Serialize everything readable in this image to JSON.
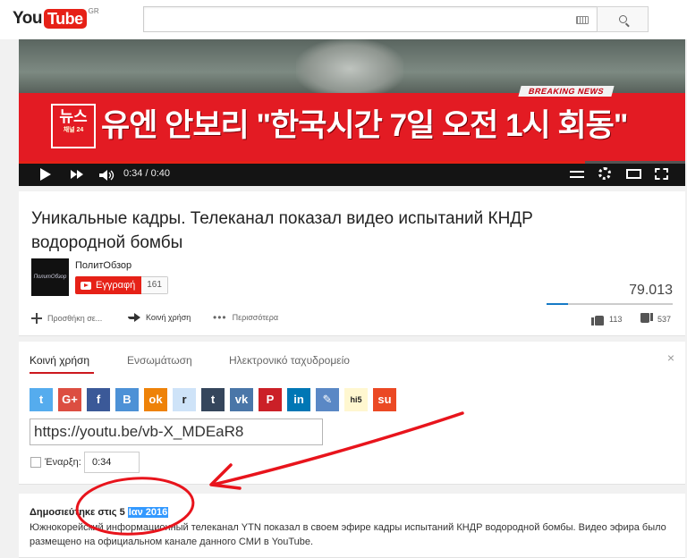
{
  "header": {
    "logo_you": "You",
    "logo_tube": "Tube",
    "logo_region": "GR",
    "search_placeholder": ""
  },
  "video": {
    "breaking_label": "BREAKING NEWS",
    "news_logo": "뉴스",
    "news_logo_sub": "채널 24",
    "headline": "유엔 안보리 \"한국시간 7일 오전 1시 회동\"",
    "time": "0:34 / 0:40",
    "progress_fraction": 0.85
  },
  "info": {
    "title": "Уникальные кадры. Телеканал показал видео испытаний КНДР водородной бомбы",
    "channel_name": "ПолитОбзор",
    "avatar_text": "ПолитОбзор",
    "subscribe_label": "Εγγραφή",
    "subscriber_count": "161",
    "views": "79.013",
    "like_fraction": 0.17,
    "actions": {
      "add": "Προσθήκη σε...",
      "share": "Κοινή χρήση",
      "more": "Περισσότερα"
    },
    "likes": "113",
    "dislikes": "537"
  },
  "share": {
    "tabs": [
      "Κοινή χρήση",
      "Ενσωμάτωση",
      "Ηλεκτρονικό ταχυδρομείο"
    ],
    "close": "×",
    "socials": [
      {
        "name": "twitter",
        "glyph": "t",
        "color": "#55acee"
      },
      {
        "name": "google-plus",
        "glyph": "G+",
        "color": "#dc4e41"
      },
      {
        "name": "facebook",
        "glyph": "f",
        "color": "#3b5998"
      },
      {
        "name": "blogger",
        "glyph": "B",
        "color": "#4d91d6"
      },
      {
        "name": "odnoklassniki",
        "glyph": "ok",
        "color": "#ee8208"
      },
      {
        "name": "reddit",
        "glyph": "r",
        "color": "#cee3f8"
      },
      {
        "name": "tumblr",
        "glyph": "t",
        "color": "#35465c"
      },
      {
        "name": "vk",
        "glyph": "vk",
        "color": "#4a76a8"
      },
      {
        "name": "pinterest",
        "glyph": "P",
        "color": "#cb2027"
      },
      {
        "name": "linkedin",
        "glyph": "in",
        "color": "#0077b5"
      },
      {
        "name": "livejournal",
        "glyph": "✎",
        "color": "#5a88c5"
      },
      {
        "name": "hi5",
        "glyph": "hi5",
        "color": "#fff7d0"
      },
      {
        "name": "stumbleupon",
        "glyph": "su",
        "color": "#eb4924"
      }
    ],
    "url": "https://youtu.be/vb-X_MDEaR8",
    "start_label": "Έναρξη:",
    "start_value": "0:34"
  },
  "description": {
    "published_prefix": "Δημοσιεύτηκε στις 5 ",
    "published_date": "Ιαν 2016",
    "text": "Южнокорейский информационный телеканал YTN показал в своем эфире кадры испытаний КНДР водородной бомбы. Видео эфира было размещено на официальном канале данного СМИ в YouTube."
  },
  "colors": {
    "youtube_red": "#e62117",
    "annotation_red": "#e8141c",
    "link_blue": "#167ac6",
    "selection_blue": "#3399ff"
  }
}
